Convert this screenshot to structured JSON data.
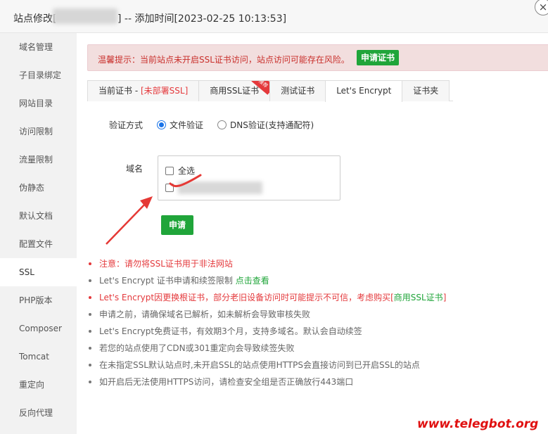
{
  "window": {
    "title_prefix": "站点修改[",
    "title_suffix": "] -- 添加时间[2023-02-25 10:13:53]",
    "close_label": "×"
  },
  "sidebar": {
    "items": [
      {
        "label": "域名管理"
      },
      {
        "label": "子目录绑定"
      },
      {
        "label": "网站目录"
      },
      {
        "label": "访问限制"
      },
      {
        "label": "流量限制"
      },
      {
        "label": "伪静态"
      },
      {
        "label": "默认文档"
      },
      {
        "label": "配置文件"
      },
      {
        "label": "SSL",
        "active": true
      },
      {
        "label": "PHP版本"
      },
      {
        "label": "Composer"
      },
      {
        "label": "Tomcat"
      },
      {
        "label": "重定向"
      },
      {
        "label": "反向代理"
      }
    ]
  },
  "alert": {
    "text": "温馨提示：当前站点未开启SSL证书访问，站点访问可能存在风险。",
    "button": "申请证书"
  },
  "tabs": {
    "current_cert_label": "当前证书 - ",
    "current_cert_status": "[未部署SSL]",
    "commercial": "商用SSL证书",
    "commercial_ribbon": "推荐",
    "test": "测试证书",
    "letsencrypt": "Let's Encrypt",
    "folder": "证书夹"
  },
  "verify": {
    "label": "验证方式",
    "options": [
      {
        "label": "文件验证",
        "checked": true
      },
      {
        "label": "DNS验证(支持通配符)",
        "checked": false
      }
    ]
  },
  "domain": {
    "label": "域名",
    "select_all": "全选",
    "apply_button": "申请"
  },
  "notes": {
    "n1": "注意：请勿将SSL证书用于非法网站",
    "n2_text": "Let's Encrypt 证书申请和续签限制 ",
    "n2_link": "点击查看",
    "n3_text": "Let's Encrypt因更换根证书，部分老旧设备访问时可能提示不可信，考虑购买",
    "n3_bracket_open": "[",
    "n3_link": "商用SSL证书",
    "n3_bracket_close": "]",
    "n4": "申请之前，请确保域名已解析，如未解析会导致审核失败",
    "n5": "Let's Encrypt免费证书，有效期3个月，支持多域名。默认会自动续签",
    "n6": "若您的站点使用了CDN或301重定向会导致续签失败",
    "n7": "在未指定SSL默认站点时,未开启SSL的站点使用HTTPS会直接访问到已开启SSL的站点",
    "n8": "如开启后无法使用HTTPS访问，请检查安全组是否正确放行443端口"
  },
  "watermark": "www.telegbot.org",
  "colors": {
    "accent_green": "#20a53a",
    "danger_red": "#e4393c",
    "alert_bg": "#f2dede"
  }
}
